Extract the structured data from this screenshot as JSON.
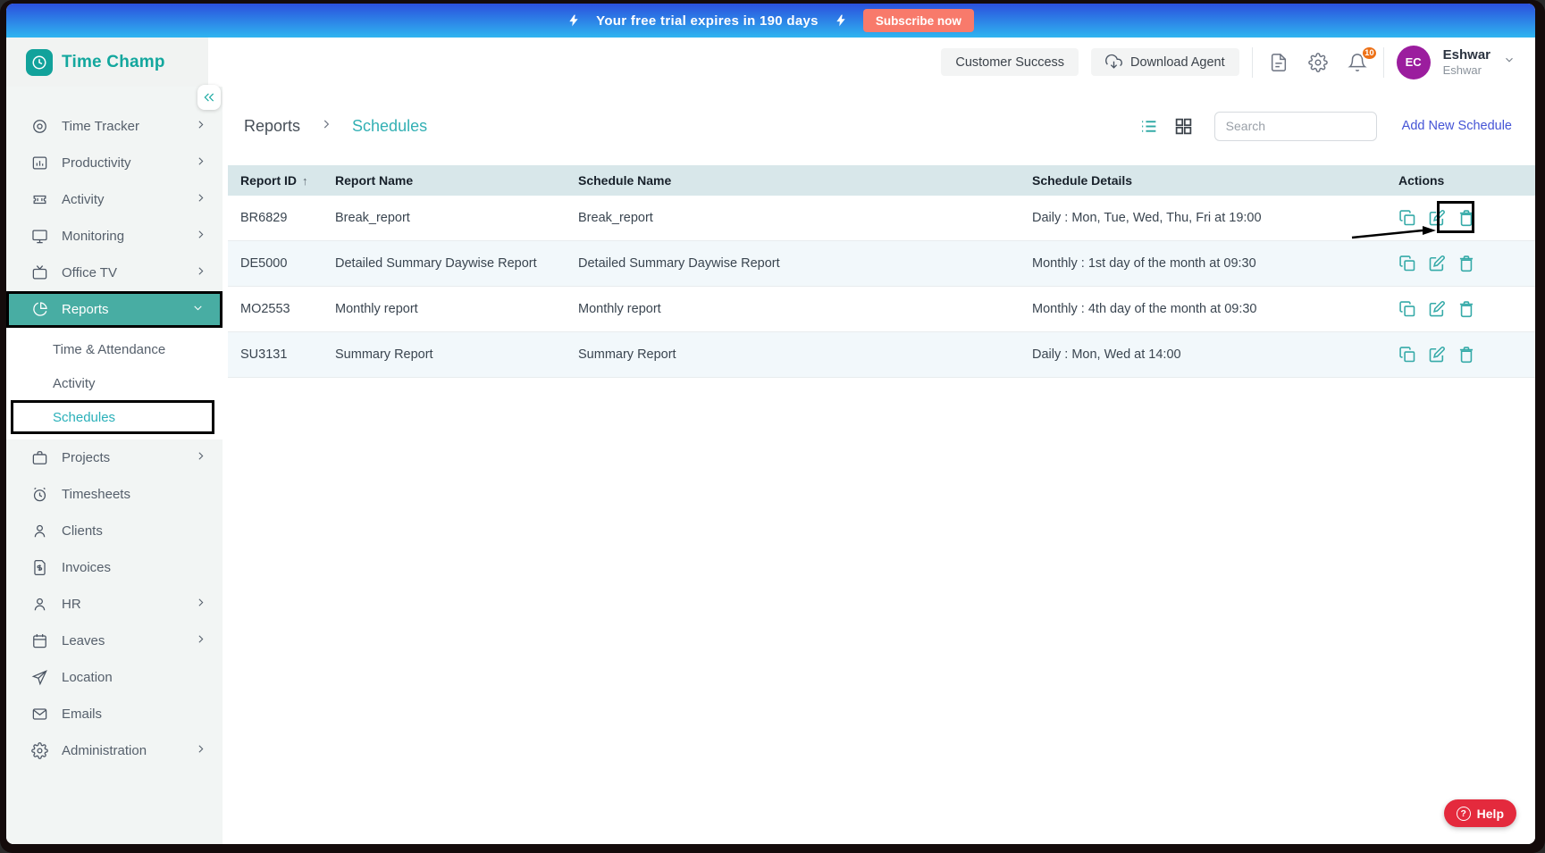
{
  "banner": {
    "message": "Your free trial expires in 190 days",
    "cta_label": "Subscribe now"
  },
  "header": {
    "brand": "Time Champ",
    "customer_success_label": "Customer Success",
    "download_agent_label": "Download Agent",
    "notification_count": "10",
    "user": {
      "initials": "EC",
      "name": "Eshwar",
      "subtitle": "Eshwar"
    }
  },
  "sidebar": {
    "items": [
      {
        "label": "Time Tracker"
      },
      {
        "label": "Productivity"
      },
      {
        "label": "Activity"
      },
      {
        "label": "Monitoring"
      },
      {
        "label": "Office TV"
      },
      {
        "label": "Reports"
      }
    ],
    "submenu": [
      {
        "label": "Time & Attendance"
      },
      {
        "label": "Activity"
      },
      {
        "label": "Schedules"
      }
    ],
    "items_lower": [
      {
        "label": "Projects"
      },
      {
        "label": "Timesheets"
      },
      {
        "label": "Clients"
      },
      {
        "label": "Invoices"
      },
      {
        "label": "HR"
      },
      {
        "label": "Leaves"
      },
      {
        "label": "Location"
      },
      {
        "label": "Emails"
      },
      {
        "label": "Administration"
      }
    ]
  },
  "breadcrumb": {
    "parent": "Reports",
    "current": "Schedules"
  },
  "toolbar": {
    "search_placeholder": "Search",
    "add_button_label": "Add New Schedule"
  },
  "table": {
    "columns": [
      "Report ID",
      "Report Name",
      "Schedule Name",
      "Schedule Details",
      "Actions"
    ],
    "sort_indicator": "↑",
    "rows": [
      {
        "id": "BR6829",
        "report_name": "Break_report",
        "schedule_name": "Break_report",
        "details": "Daily : Mon, Tue, Wed, Thu, Fri at 19:00"
      },
      {
        "id": "DE5000",
        "report_name": "Detailed Summary Daywise Report",
        "schedule_name": "Detailed Summary Daywise Report",
        "details": "Monthly : 1st day of the month at 09:30"
      },
      {
        "id": "MO2553",
        "report_name": "Monthly report",
        "schedule_name": "Monthly report",
        "details": "Monthly : 4th day of the month at 09:30"
      },
      {
        "id": "SU3131",
        "report_name": "Summary Report",
        "schedule_name": "Summary Report",
        "details": "Daily : Mon, Wed at 14:00"
      }
    ]
  },
  "help": {
    "label": "Help",
    "icon_glyph": "?"
  },
  "colors": {
    "brand_teal": "#13a79e",
    "selected_teal": "#48ada3",
    "banner_gradient_top": "#2b50dd",
    "banner_gradient_bottom": "#2fb5f0",
    "subscribe_coral": "#f87a6b",
    "avatar_purple": "#9b1d9e",
    "badge_orange": "#ed7117",
    "table_header_bg": "#d8e7ea",
    "row_alt_bg": "#f2f8fb",
    "action_teal": "#35aaa8",
    "add_link_blue": "#4554d6",
    "help_red": "#e42a3d"
  }
}
